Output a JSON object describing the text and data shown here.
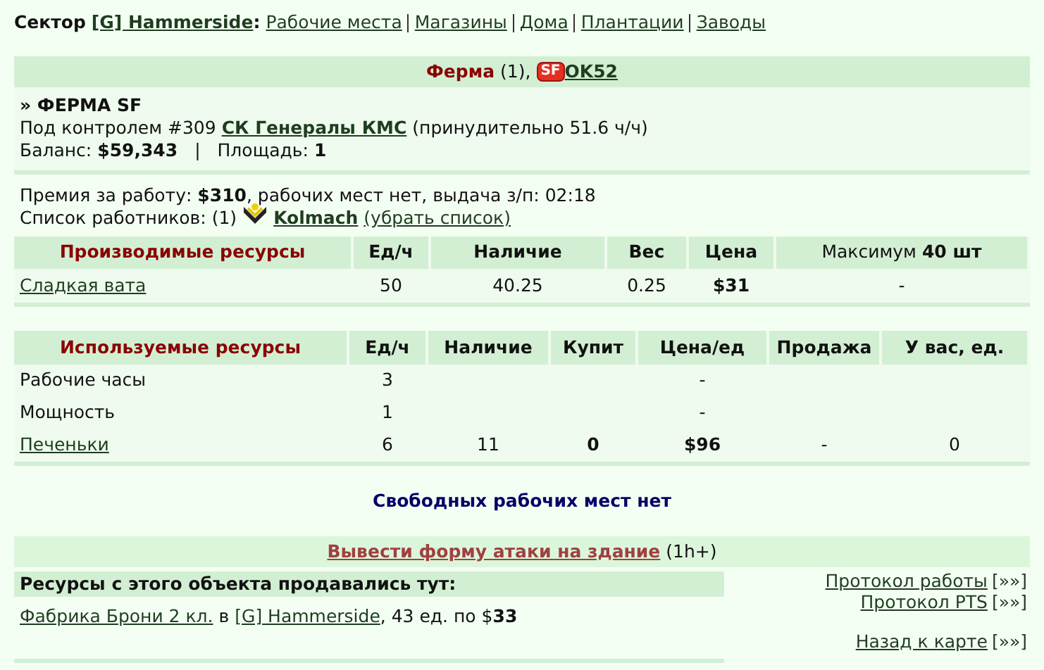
{
  "sector": {
    "label": "Сектор",
    "name": "[G] Hammerside",
    "colon": ":",
    "links": [
      {
        "label": "Рабочие места"
      },
      {
        "label": "Магазины"
      },
      {
        "label": "Дома"
      },
      {
        "label": "Плантации"
      },
      {
        "label": "Заводы"
      }
    ]
  },
  "header": {
    "title": "Ферма",
    "count": "(1),",
    "badge": "SF",
    "owner": "OK52"
  },
  "info": {
    "name": "» ФЕРМА SF",
    "control_prefix": "Под контролем #309",
    "corporation": "СК Генералы КМС",
    "control_suffix": "(принудительно 51.6 ч/ч)",
    "balance": "Баланс: **$59,343**",
    "separator": "|",
    "area": "Площадь: **1**"
  },
  "bonus": "Премия за работу: **$310**, рабочих мест нет, выдача з/п: 02:18",
  "workers": {
    "label": "Список работников: (1)",
    "name": "Kolmach",
    "remove": "(убрать список)"
  },
  "produced": {
    "columns": [
      "Производимые ресурсы",
      "Ед/ч",
      "Наличие",
      "Вес",
      "Цена",
      "Максимум **40 шт**"
    ],
    "rows": [
      {
        "name": "Сладкая вата",
        "per_hour": "50",
        "stock": "40.25",
        "weight": "0.25",
        "price": "$31",
        "max": "-"
      }
    ]
  },
  "used": {
    "columns": [
      "Используемые ресурсы",
      "Ед/ч",
      "Наличие",
      "Купит",
      "Цена/ед",
      "Продажа",
      "У вас, ед."
    ],
    "rows": [
      {
        "name": "Рабочие часы",
        "link": false,
        "per_hour": "3",
        "price": "-"
      },
      {
        "name": "Мощность",
        "link": false,
        "per_hour": "1",
        "price": "-"
      },
      {
        "name": "Печеньки",
        "link": true,
        "per_hour": "6",
        "stock": "11",
        "buy": "0",
        "price": "$96",
        "sale": "-",
        "yours": "0"
      }
    ]
  },
  "no_jobs": "Свободных рабочих мест нет",
  "attack": {
    "link": "Вывести форму атаки на здание",
    "note": "(1h+)"
  },
  "sold": {
    "title": "Ресурсы с этого объекта продавались тут:",
    "entries": [
      {
        "building": "Фабрика Брони 2 кл.",
        "in": "в",
        "sector": "[G] Hammerside",
        "rest": ", 43 ед. по $**33**"
      }
    ]
  },
  "side_links": [
    {
      "label": "Протокол работы",
      "arrow": "[»»]"
    },
    {
      "label": "Протокол PTS",
      "arrow": "[»»]"
    }
  ],
  "back_link": {
    "label": "Назад к карте",
    "arrow": "[»»]"
  }
}
